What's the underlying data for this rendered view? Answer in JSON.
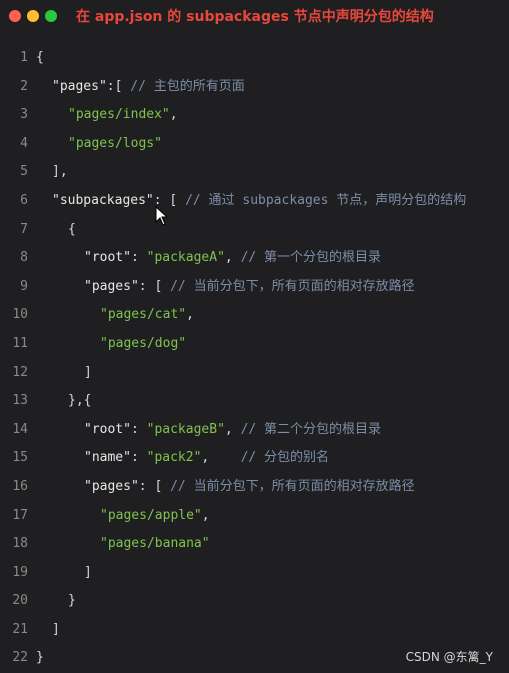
{
  "window": {
    "title": "在 app.json 的 subpackages 节点中声明分包的结构",
    "controls": [
      "close",
      "minimize",
      "maximize"
    ]
  },
  "code": {
    "lines": [
      {
        "no": "1",
        "indent": 0,
        "parts": [
          {
            "t": "p",
            "v": "{"
          }
        ]
      },
      {
        "no": "2",
        "indent": 1,
        "parts": [
          {
            "t": "k",
            "v": "\"pages\""
          },
          {
            "t": "p",
            "v": ":[ "
          },
          {
            "t": "c",
            "v": "// 主包的所有页面"
          }
        ]
      },
      {
        "no": "3",
        "indent": 2,
        "parts": [
          {
            "t": "s",
            "v": "\"pages/index\""
          },
          {
            "t": "p",
            "v": ","
          }
        ]
      },
      {
        "no": "4",
        "indent": 2,
        "parts": [
          {
            "t": "s",
            "v": "\"pages/logs\""
          }
        ]
      },
      {
        "no": "5",
        "indent": 1,
        "parts": [
          {
            "t": "p",
            "v": "],"
          }
        ]
      },
      {
        "no": "6",
        "indent": 1,
        "parts": [
          {
            "t": "k",
            "v": "\"subpackages\""
          },
          {
            "t": "p",
            "v": ": [ "
          },
          {
            "t": "c",
            "v": "// 通过 subpackages 节点，声明分包的结构"
          }
        ]
      },
      {
        "no": "7",
        "indent": 2,
        "parts": [
          {
            "t": "p",
            "v": "{"
          }
        ]
      },
      {
        "no": "8",
        "indent": 3,
        "parts": [
          {
            "t": "k",
            "v": "\"root\""
          },
          {
            "t": "p",
            "v": ": "
          },
          {
            "t": "s",
            "v": "\"packageA\""
          },
          {
            "t": "p",
            "v": ", "
          },
          {
            "t": "c",
            "v": "// 第一个分包的根目录"
          }
        ]
      },
      {
        "no": "9",
        "indent": 3,
        "parts": [
          {
            "t": "k",
            "v": "\"pages\""
          },
          {
            "t": "p",
            "v": ": [ "
          },
          {
            "t": "c",
            "v": "// 当前分包下，所有页面的相对存放路径"
          }
        ]
      },
      {
        "no": "10",
        "indent": 4,
        "parts": [
          {
            "t": "s",
            "v": "\"pages/cat\""
          },
          {
            "t": "p",
            "v": ","
          }
        ]
      },
      {
        "no": "11",
        "indent": 4,
        "parts": [
          {
            "t": "s",
            "v": "\"pages/dog\""
          }
        ]
      },
      {
        "no": "12",
        "indent": 3,
        "parts": [
          {
            "t": "p",
            "v": "]"
          }
        ]
      },
      {
        "no": "13",
        "indent": 2,
        "parts": [
          {
            "t": "p",
            "v": "},{"
          }
        ]
      },
      {
        "no": "14",
        "indent": 3,
        "parts": [
          {
            "t": "k",
            "v": "\"root\""
          },
          {
            "t": "p",
            "v": ": "
          },
          {
            "t": "s",
            "v": "\"packageB\""
          },
          {
            "t": "p",
            "v": ", "
          },
          {
            "t": "c",
            "v": "// 第二个分包的根目录"
          }
        ]
      },
      {
        "no": "15",
        "indent": 3,
        "parts": [
          {
            "t": "k",
            "v": "\"name\""
          },
          {
            "t": "p",
            "v": ": "
          },
          {
            "t": "s",
            "v": "\"pack2\""
          },
          {
            "t": "p",
            "v": ",    "
          },
          {
            "t": "c",
            "v": "// 分包的别名"
          }
        ]
      },
      {
        "no": "16",
        "indent": 3,
        "parts": [
          {
            "t": "k",
            "v": "\"pages\""
          },
          {
            "t": "p",
            "v": ": [ "
          },
          {
            "t": "c",
            "v": "// 当前分包下，所有页面的相对存放路径"
          }
        ]
      },
      {
        "no": "17",
        "indent": 4,
        "parts": [
          {
            "t": "s",
            "v": "\"pages/apple\""
          },
          {
            "t": "p",
            "v": ","
          }
        ]
      },
      {
        "no": "18",
        "indent": 4,
        "parts": [
          {
            "t": "s",
            "v": "\"pages/banana\""
          }
        ]
      },
      {
        "no": "19",
        "indent": 3,
        "parts": [
          {
            "t": "p",
            "v": "]"
          }
        ]
      },
      {
        "no": "20",
        "indent": 2,
        "parts": [
          {
            "t": "p",
            "v": "}"
          }
        ]
      },
      {
        "no": "21",
        "indent": 1,
        "parts": [
          {
            "t": "p",
            "v": "]"
          }
        ]
      },
      {
        "no": "22",
        "indent": 0,
        "parts": [
          {
            "t": "p",
            "v": "}"
          }
        ]
      }
    ]
  },
  "watermark": "CSDN @东篱_Y",
  "colors": {
    "background": "#1f1f21",
    "title": "#e8483c",
    "string": "#7ec44f",
    "comment": "#7d8da8",
    "key": "#e6e6e6",
    "line_number": "#8a8a8a"
  }
}
